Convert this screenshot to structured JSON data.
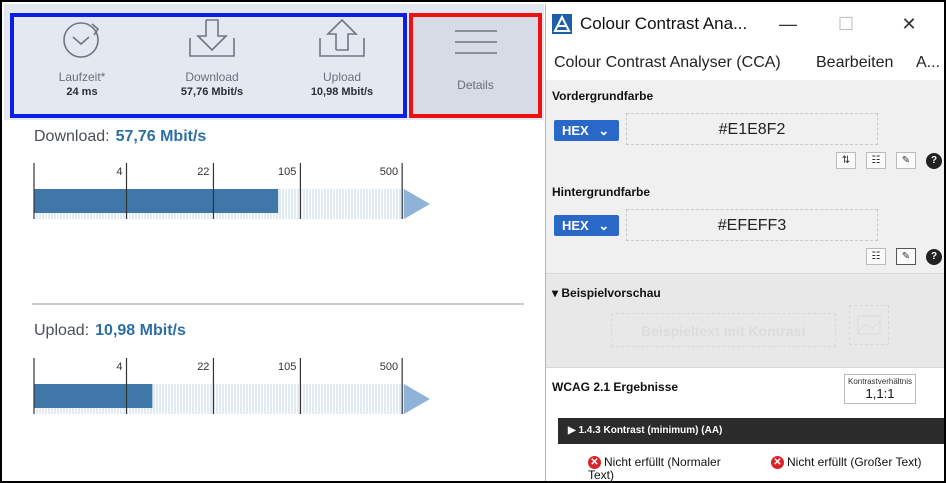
{
  "speedtest": {
    "latency": {
      "label": "Laufzeit*",
      "value": "24 ms"
    },
    "download": {
      "label": "Download",
      "value": "57,76 Mbit/s"
    },
    "upload": {
      "label": "Upload",
      "value": "10,98 Mbit/s"
    },
    "details_label": "Details",
    "download_section": {
      "title": "Download:",
      "value": "57,76 Mbit/s",
      "ticks": [
        "4",
        "22",
        "105",
        "500"
      ],
      "fill_ratio": 0.66
    },
    "upload_section": {
      "title": "Upload:",
      "value": "10,98 Mbit/s",
      "ticks": [
        "4",
        "22",
        "105",
        "500"
      ],
      "fill_ratio": 0.32
    }
  },
  "cca": {
    "window_title": "Colour Contrast Ana...",
    "window_buttons": {
      "minimize": "—",
      "maximize": "☐",
      "close": "✕"
    },
    "menu": [
      "Colour Contrast Analyser (CCA)",
      "Bearbeiten",
      "A..."
    ],
    "foreground": {
      "label": "Vordergrundfarbe",
      "format": "HEX",
      "value": "#E1E8F2"
    },
    "background": {
      "label": "Hintergrundfarbe",
      "format": "HEX",
      "value": "#EFEFF3"
    },
    "preview": {
      "label": "▾ Beispielvorschau",
      "sample_text": "Beispieltext mit Kontrast"
    },
    "results": {
      "title": "WCAG 2.1 Ergebnisse",
      "ratio_label": "Kontrastverhältnis",
      "ratio_value": "1,1:1",
      "criterion": "▶ 1.4.3 Kontrast (minimum) (AA)",
      "fail_normal": "Nicht erfüllt (Normaler Text)",
      "fail_large": "Nicht erfüllt (Großer Text)"
    },
    "colors": {
      "accent": "#2A68C8",
      "fail": "#D8232A"
    }
  },
  "annotations": {
    "blue_box": "#0B1EE6",
    "red_box": "#EF1010"
  }
}
